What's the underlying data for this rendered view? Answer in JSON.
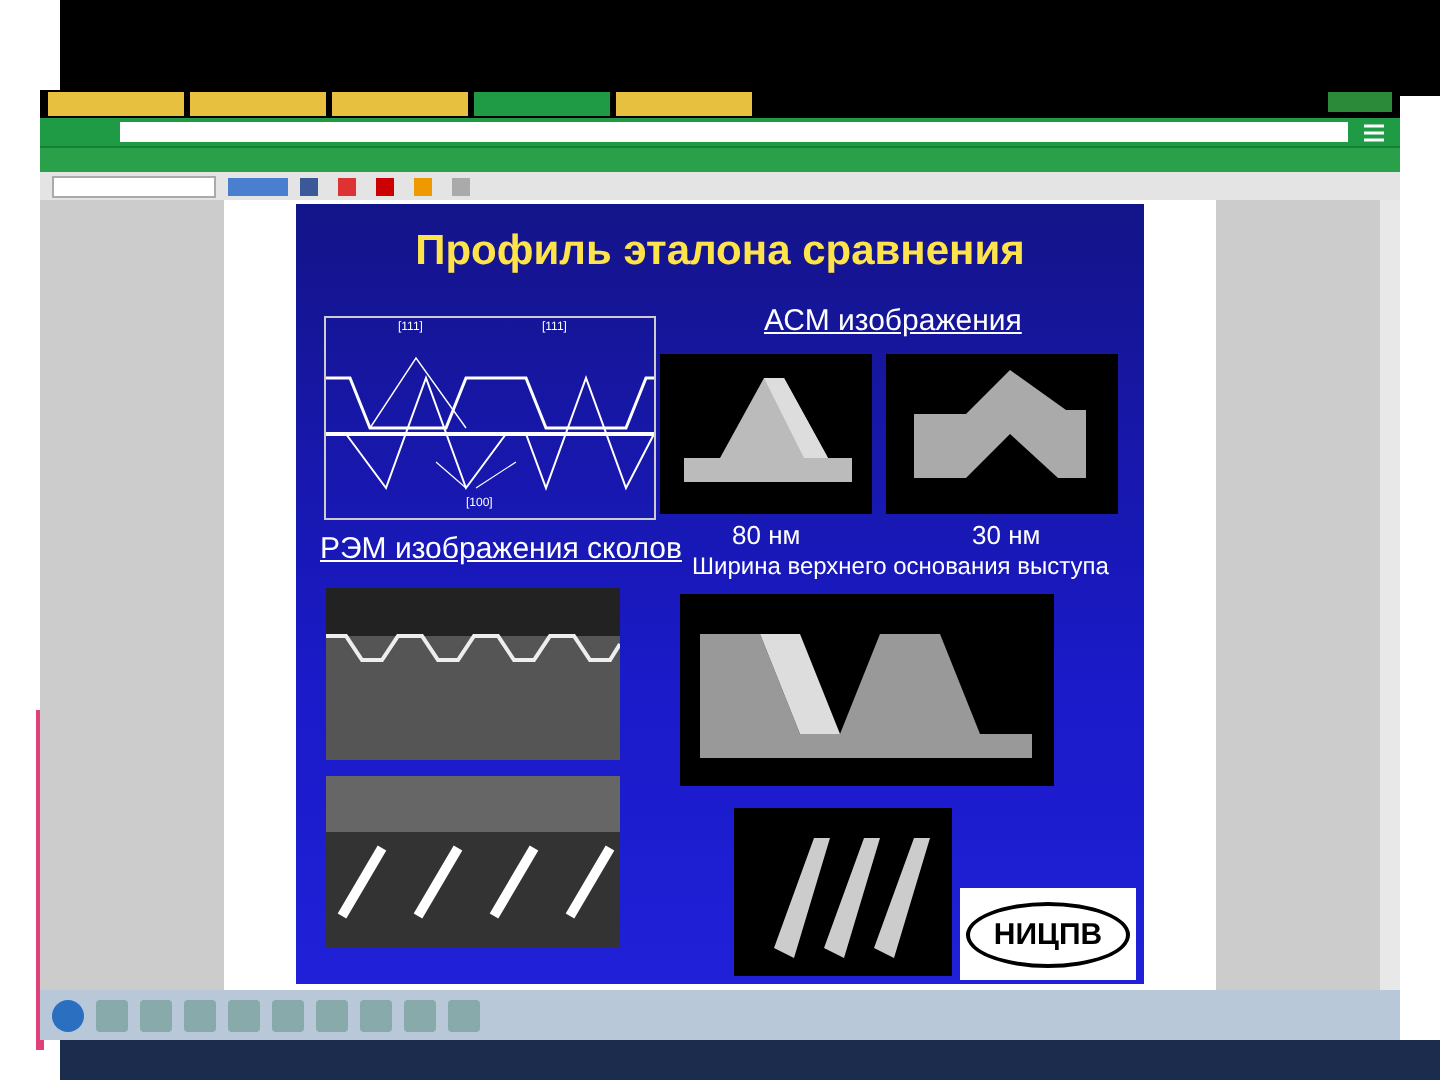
{
  "browser": {
    "tabs": [
      {
        "selected": false
      },
      {
        "selected": false
      },
      {
        "selected": false
      },
      {
        "selected": true
      },
      {
        "selected": false
      }
    ]
  },
  "slide": {
    "title": "Профиль эталона сравнения",
    "diagram_labels": [
      "[111]",
      "[111]",
      "[100]"
    ],
    "afm_heading": "АСМ изображения",
    "afm_captions": [
      "80 нм",
      "30 нм"
    ],
    "width_caption": "Ширина верхнего основания выступа",
    "sem_heading": "РЭМ изображения сколов",
    "logo": "НИЦПВ"
  }
}
